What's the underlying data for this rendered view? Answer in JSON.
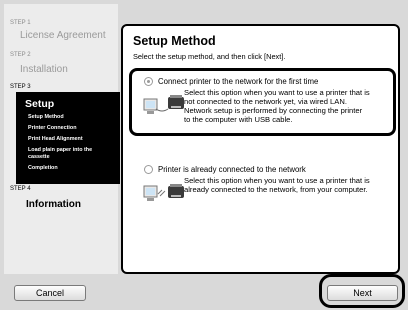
{
  "sidebar": {
    "steps": [
      {
        "num": "STEP 1",
        "title": "License Agreement"
      },
      {
        "num": "STEP 2",
        "title": "Installation"
      },
      {
        "num": "STEP 3",
        "title": "Setup",
        "substeps": [
          "Setup Method",
          "Printer Connection",
          "Print Head Alignment",
          "Load plain paper into the",
          "cassette",
          "Completion"
        ]
      },
      {
        "num": "STEP 4",
        "title": "Information"
      }
    ]
  },
  "main": {
    "title": "Setup Method",
    "subtitle": "Select the setup method, and then click [Next].",
    "options": [
      {
        "label": "Connect printer to the network for the first time",
        "desc_lines": [
          "Select this option when you want to use a printer that is",
          "not connected to the network yet, via wired LAN.",
          "Network setup is performed by connecting the printer",
          "to the computer with USB cable."
        ],
        "selected": true
      },
      {
        "label": "Printer is already connected to the network",
        "desc_lines": [
          "Select this option when you want to use a printer that is",
          "already connected to the network, from your computer."
        ],
        "selected": false
      }
    ]
  },
  "buttons": {
    "cancel": "Cancel",
    "next": "Next"
  }
}
